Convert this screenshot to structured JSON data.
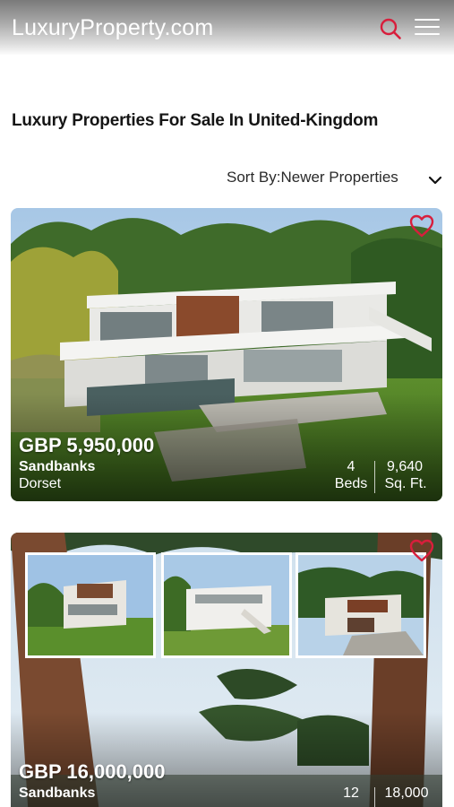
{
  "header": {
    "brand": "LuxuryProperty.com",
    "search_icon": "search-icon",
    "menu_icon": "hamburger-menu-icon",
    "accent_color": "#d81e3c"
  },
  "page": {
    "title": "Luxury Properties For Sale In United-Kingdom"
  },
  "sort": {
    "label": "Sort By:Newer Properties",
    "icon": "chevron-down-icon"
  },
  "listings": [
    {
      "price": "GBP 5,950,000",
      "city": "Sandbanks",
      "region": "Dorset",
      "beds_value": "4",
      "beds_label": "Beds",
      "area_value": "9,640",
      "area_label": "Sq. Ft.",
      "favorite_icon": "heart-outline-icon"
    },
    {
      "price": "GBP 16,000,000",
      "city": "Sandbanks",
      "beds_value": "12",
      "area_value": "18,000",
      "favorite_icon": "heart-outline-icon"
    }
  ]
}
